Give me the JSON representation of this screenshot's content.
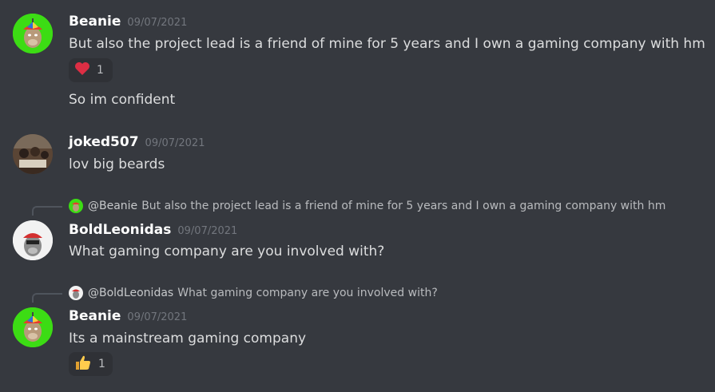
{
  "messages": [
    {
      "author": "Beanie",
      "timestamp": "09/07/2021",
      "lines": [
        "But also the project lead is a friend of mine for 5 years and I own a gaming company with hm",
        "So im confident"
      ],
      "reaction": {
        "emoji": "heart-emoji",
        "count": "1"
      }
    },
    {
      "author": "joked507",
      "timestamp": "09/07/2021",
      "lines": [
        "lov big beards"
      ]
    },
    {
      "reply_to": {
        "mention": "@Beanie",
        "text": "But also the project lead is a friend of mine for 5 years and I own a gaming company with hm"
      },
      "author": "BoldLeonidas",
      "timestamp": "09/07/2021",
      "lines": [
        "What gaming company are you involved with?"
      ]
    },
    {
      "reply_to": {
        "mention": "@BoldLeonidas",
        "text": "What gaming company are you involved with?"
      },
      "author": "Beanie",
      "timestamp": "09/07/2021",
      "lines": [
        "Its a mainstream gaming company"
      ],
      "reaction": {
        "emoji": "thumbs-up-emoji",
        "count": "1"
      }
    }
  ],
  "colors": {
    "background": "#36393f",
    "reaction_bg": "#2f3136",
    "username": "#ffffff",
    "timestamp": "#72767d",
    "beanie_avatar_bg": "#3cdc14"
  }
}
